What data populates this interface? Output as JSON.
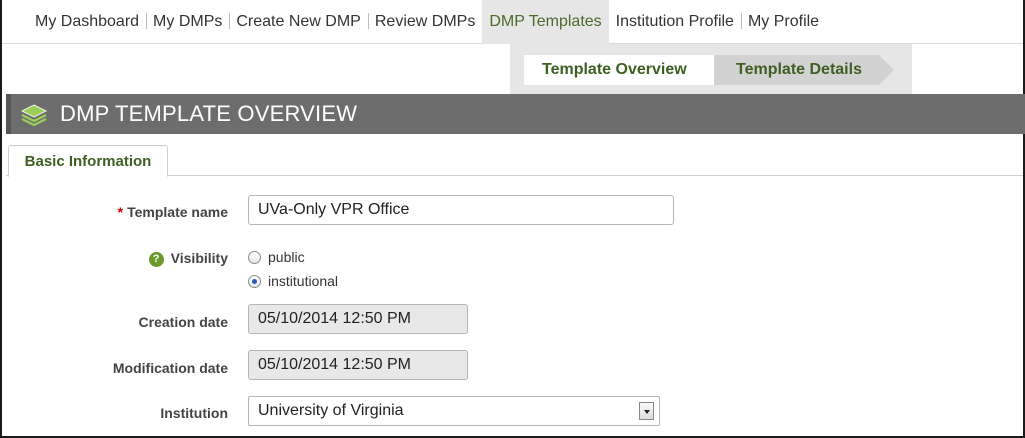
{
  "nav": {
    "items": [
      {
        "label": "My Dashboard"
      },
      {
        "label": "My DMPs"
      },
      {
        "label": "Create New DMP"
      },
      {
        "label": "Review DMPs"
      },
      {
        "label": "DMP Templates",
        "active": true
      },
      {
        "label": "Institution Profile"
      },
      {
        "label": "My Profile"
      }
    ]
  },
  "wizard": {
    "steps": [
      "Template Overview",
      "Template Details"
    ]
  },
  "page": {
    "title": "DMP TEMPLATE OVERVIEW",
    "title_icon": "layers-icon"
  },
  "tabs": [
    "Basic Information"
  ],
  "form": {
    "required_marker": "*",
    "template_name": {
      "label": "Template name",
      "value": "UVa-Only VPR Office"
    },
    "visibility": {
      "label": "Visibility",
      "help_icon": "?",
      "options": [
        "public",
        "institutional"
      ],
      "selected": "institutional"
    },
    "creation_date": {
      "label": "Creation date",
      "value": "05/10/2014 12:50 PM"
    },
    "modification_date": {
      "label": "Modification date",
      "value": "05/10/2014 12:50 PM"
    },
    "institution": {
      "label": "Institution",
      "value": "University of Virginia"
    }
  },
  "colors": {
    "accent_green": "#3f5f22",
    "title_bar": "#6d6d6d",
    "required": "#cc0000"
  }
}
